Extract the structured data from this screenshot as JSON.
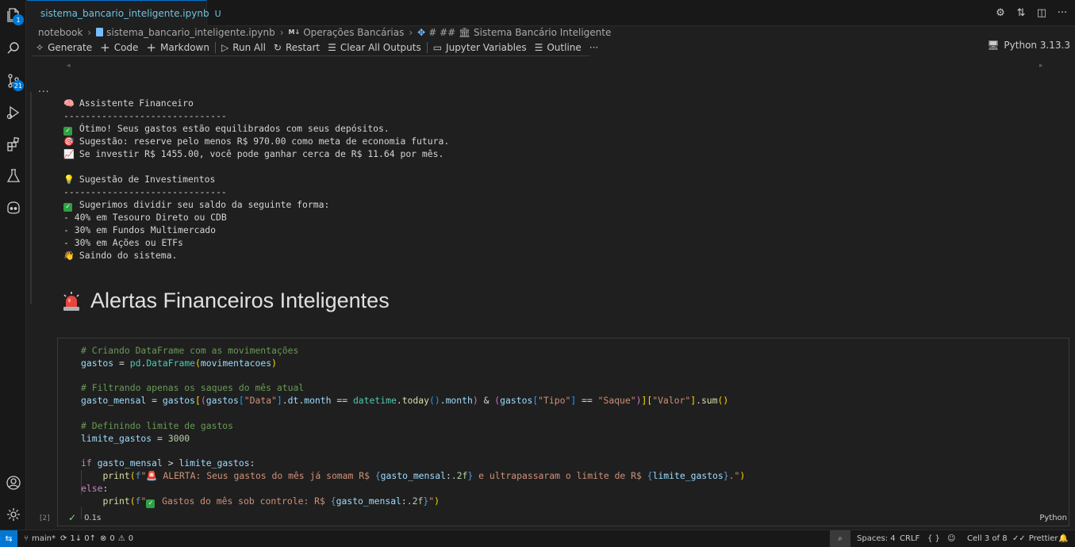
{
  "activity_bar": {
    "explorer_badge": "1",
    "scm_badge": "21"
  },
  "tab": {
    "filename": "sistema_bancario_inteligente.ipynb",
    "modified_flag": "U"
  },
  "breadcrumb": {
    "items": [
      "notebook",
      "sistema_bancario_inteligente.ipynb",
      "Operações Bancárias",
      "# ## 🏛 Sistema Bancário Inteligente"
    ],
    "md_badge": "M↓"
  },
  "toolbar": {
    "generate": "Generate",
    "code": "Code",
    "markdown": "Markdown",
    "run_all": "Run All",
    "restart": "Restart",
    "clear_all": "Clear All Outputs",
    "jupyter_variables": "Jupyter Variables",
    "outline": "Outline",
    "more": "···",
    "kernel": "Python 3.13.3"
  },
  "output": {
    "ellipsis": "...",
    "lines": [
      {
        "icon": "🧠",
        "text": " Assistente Financeiro"
      },
      {
        "icon": "",
        "text": "------------------------------"
      },
      {
        "icon": "✅",
        "text": " Ótimo! Seus gastos estão equilibrados com seus depósitos."
      },
      {
        "icon": "🎯",
        "text": " Sugestão: reserve pelo menos R$ 970.00 como meta de economia futura."
      },
      {
        "icon": "📈",
        "text": " Se investir R$ 1455.00, você pode ganhar cerca de R$ 11.64 por mês."
      },
      {
        "icon": "",
        "text": ""
      },
      {
        "icon": "💡",
        "text": " Sugestão de Investimentos"
      },
      {
        "icon": "",
        "text": "------------------------------"
      },
      {
        "icon": "✅",
        "text": " Sugerimos dividir seu saldo da seguinte forma:"
      },
      {
        "icon": "",
        "text": "- 40% em Tesouro Direto ou CDB"
      },
      {
        "icon": "",
        "text": "- 30% em Fundos Multimercado"
      },
      {
        "icon": "",
        "text": "- 30% em Ações ou ETFs"
      },
      {
        "icon": "👋",
        "text": " Saindo do sistema."
      }
    ]
  },
  "markdown_cell": {
    "heading": "Alertas Financeiros Inteligentes"
  },
  "code_cell": {
    "comment1": "# Criando DataFrame com as movimentações",
    "comment2": "# Filtrando apenas os saques do mês atual",
    "comment3": "# Definindo limite de gastos",
    "limit_value": "3000",
    "alert_text": " ALERTA: Seus gastos do mês já somam R$ ",
    "alert_text2": " e ultrapassaram o limite de R$ ",
    "ok_text": " Gastos do mês sob controle: R$ ",
    "execution_count": "[2]",
    "exec_time": "0.1s",
    "language": "Python"
  },
  "status_bar": {
    "branch": "main*",
    "sync": "1↓ 0↑",
    "errors": "0",
    "warnings": "0",
    "spaces": "Spaces: 4",
    "eol": "CRLF",
    "braces": "{ }",
    "cell": "Cell 3 of 8",
    "prettier": "Prettier"
  },
  "colors": {
    "accent": "#0078d4",
    "background": "#1f1f1f",
    "comment": "#6a9955",
    "string": "#ce9178"
  }
}
